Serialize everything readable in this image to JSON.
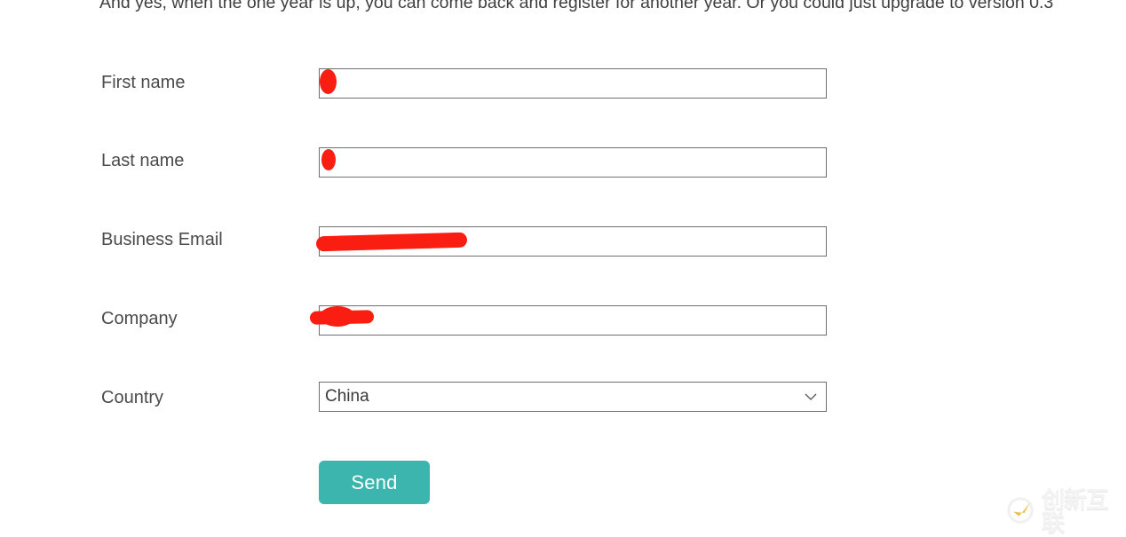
{
  "page": {
    "intro_text": "And yes, when the one year is up, you can come back and register for another year. Or you could just upgrade to version 0.3"
  },
  "form": {
    "fields": [
      {
        "label": "First name",
        "type": "text",
        "value": "",
        "placeholder": "",
        "redacted": true
      },
      {
        "label": "Last name",
        "type": "text",
        "value": "",
        "placeholder": "",
        "redacted": true
      },
      {
        "label": "Business Email",
        "type": "text",
        "value": "",
        "placeholder": "",
        "redacted": true
      },
      {
        "label": "Company",
        "type": "text",
        "value": "",
        "placeholder": "",
        "redacted": true
      },
      {
        "label": "Country",
        "type": "select",
        "value": "China",
        "placeholder": "",
        "redacted": false
      }
    ],
    "submit_label": "Send",
    "submit_color": "#3bb5ad",
    "redaction_color": "#f91d12"
  },
  "watermark": {
    "text": "创新互联",
    "icon": "circle-check-logo-icon"
  }
}
